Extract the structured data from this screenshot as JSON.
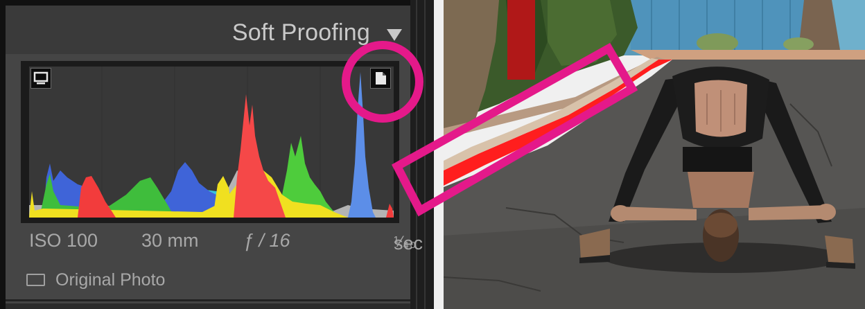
{
  "panel": {
    "title": "Soft Proofing",
    "expand_icon": "triangle-down-icon"
  },
  "histogram": {
    "shadow_clip_icon": "monitor-icon",
    "highlight_clip_icon": "page-icon"
  },
  "exif": {
    "iso": "ISO 100",
    "focal_length": "30 mm",
    "aperture": "ƒ / 16",
    "shutter_fraction": "¹⁄₄₀",
    "shutter_unit": "sec"
  },
  "original_photo": {
    "label": "Original Photo",
    "checked": false
  },
  "colors": {
    "annotation": "#e4198a",
    "panel_bg": "#454545",
    "header_bg": "#3a3a3a",
    "text": "#a8a8a8",
    "clip_warning": "#ff1e1e"
  }
}
